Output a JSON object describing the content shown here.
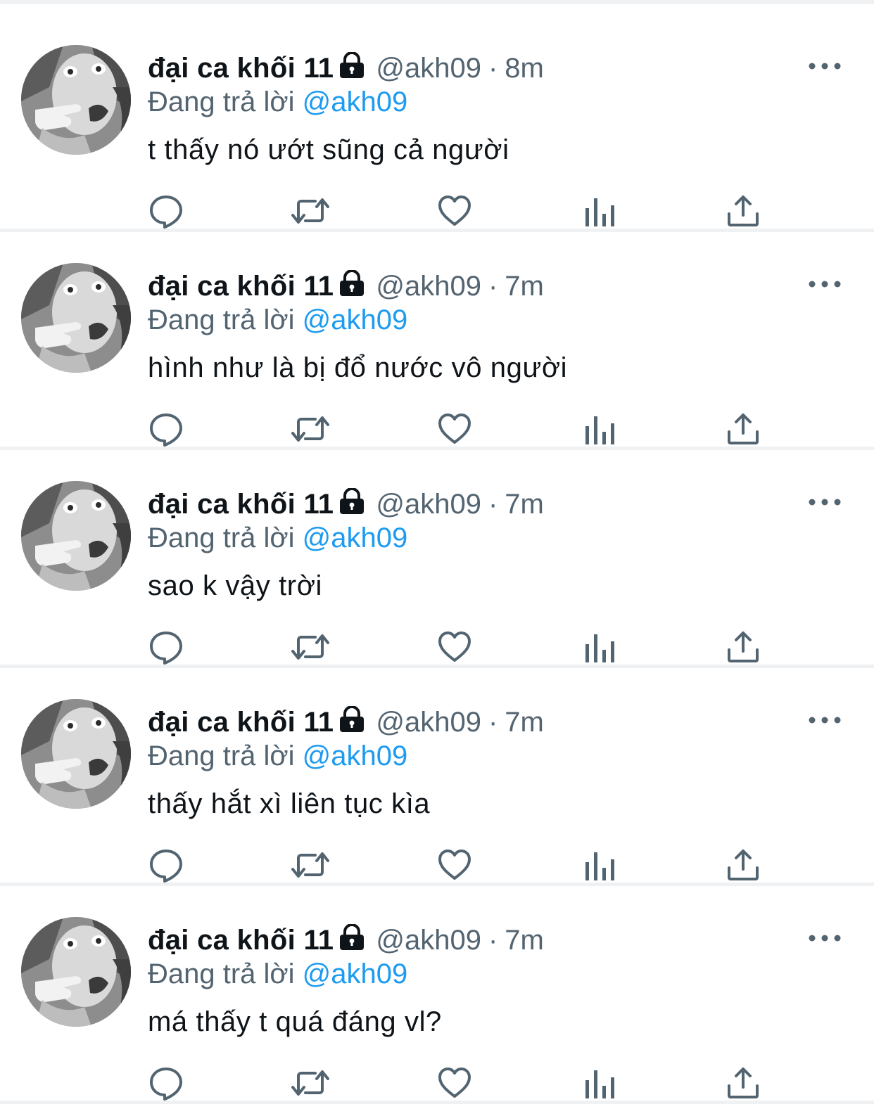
{
  "colors": {
    "primary_text": "#0f1419",
    "secondary_text": "#536471",
    "link_blue": "#1d9bf0",
    "divider": "#eff1f3"
  },
  "icons": {
    "lock": "lock-icon",
    "more": "more-icon",
    "reply": "reply-icon",
    "retweet": "retweet-icon",
    "like": "like-icon",
    "views": "views-icon",
    "share": "share-icon"
  },
  "tweets": [
    {
      "name": "đại ca khối 11",
      "handle": "@akh09",
      "separator": "·",
      "time": "8m",
      "reply_prefix": "Đang trả lời",
      "reply_to": "@akh09",
      "text": "t thấy nó ướt sũng cả người"
    },
    {
      "name": "đại ca khối 11",
      "handle": "@akh09",
      "separator": "·",
      "time": "7m",
      "reply_prefix": "Đang trả lời",
      "reply_to": "@akh09",
      "text": "hình như là bị đổ nước vô người"
    },
    {
      "name": "đại ca khối 11",
      "handle": "@akh09",
      "separator": "·",
      "time": "7m",
      "reply_prefix": "Đang trả lời",
      "reply_to": "@akh09",
      "text": "sao k vậy trời"
    },
    {
      "name": "đại ca khối 11",
      "handle": "@akh09",
      "separator": "·",
      "time": "7m",
      "reply_prefix": "Đang trả lời",
      "reply_to": "@akh09",
      "text": "thấy hắt xì liên tục kìa"
    },
    {
      "name": "đại ca khối 11",
      "handle": "@akh09",
      "separator": "·",
      "time": "7m",
      "reply_prefix": "Đang trả lời",
      "reply_to": "@akh09",
      "text": "má thấy t quá đáng vl?"
    }
  ]
}
